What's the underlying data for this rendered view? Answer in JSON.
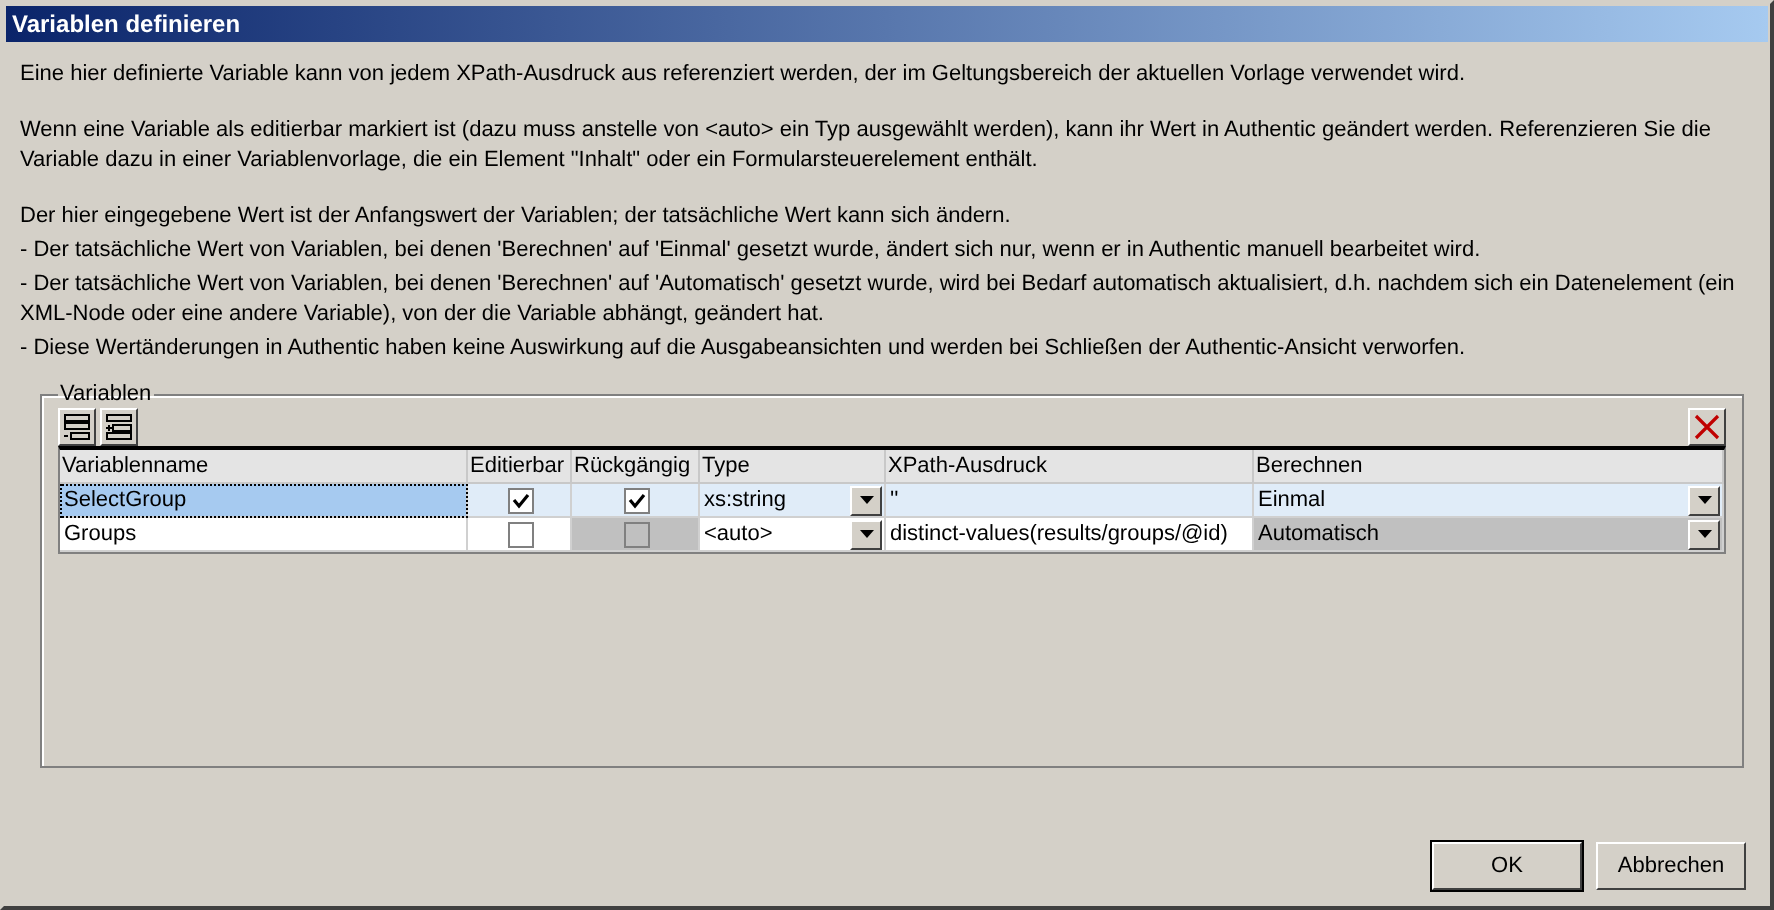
{
  "window": {
    "title": "Variablen definieren"
  },
  "sections": [
    [
      "Eine hier definierte Variable kann von jedem XPath-Ausdruck aus referenziert werden, der im Geltungsbereich der aktuellen Vorlage verwendet wird."
    ],
    [
      "Wenn eine Variable als editierbar markiert ist (dazu muss anstelle von <auto> ein Typ ausgewählt werden), kann ihr Wert in Authentic geändert werden. Referenzieren Sie die Variable dazu in einer Variablenvorlage, die ein Element \"Inhalt\" oder ein Formularsteuerelement enthält."
    ],
    [
      "Der hier eingegebene Wert ist der Anfangswert der Variablen; der tatsächliche Wert kann sich ändern.",
      "- Der tatsächliche Wert von Variablen, bei denen 'Berechnen' auf 'Einmal' gesetzt wurde, ändert sich nur, wenn er in Authentic manuell bearbeitet wird.",
      "- Der tatsächliche Wert von Variablen, bei denen 'Berechnen' auf 'Automatisch' gesetzt wurde, wird bei Bedarf automatisch aktualisiert, d.h. nachdem sich ein Datenelement (ein XML-Node oder eine andere Variable), von der die Variable abhängt, geändert hat.",
      "- Diese Wertänderungen in Authentic haben keine Auswirkung auf die Ausgabeansichten und werden bei Schließen der Authentic-Ansicht verworfen."
    ]
  ],
  "group": {
    "label": "Variablen",
    "columns": [
      "Variablenname",
      "Editierbar",
      "Rückgängig",
      "Type",
      "XPath-Ausdruck",
      "Berechnen"
    ],
    "rows": [
      {
        "name": "SelectGroup",
        "selected": true,
        "editable": true,
        "undo": true,
        "undo_disabled": false,
        "type": "xs:string",
        "xpath": "''",
        "calc": "Einmal",
        "calc_disabled": false
      },
      {
        "name": "Groups",
        "selected": false,
        "editable": false,
        "undo": false,
        "undo_disabled": true,
        "type": "<auto>",
        "xpath": "distinct-values(results/groups/@id)",
        "calc": "Automatisch",
        "calc_disabled": true
      }
    ]
  },
  "buttons": [
    {
      "label": "OK",
      "default": true
    },
    {
      "label": "Abbrechen",
      "default": false
    }
  ]
}
